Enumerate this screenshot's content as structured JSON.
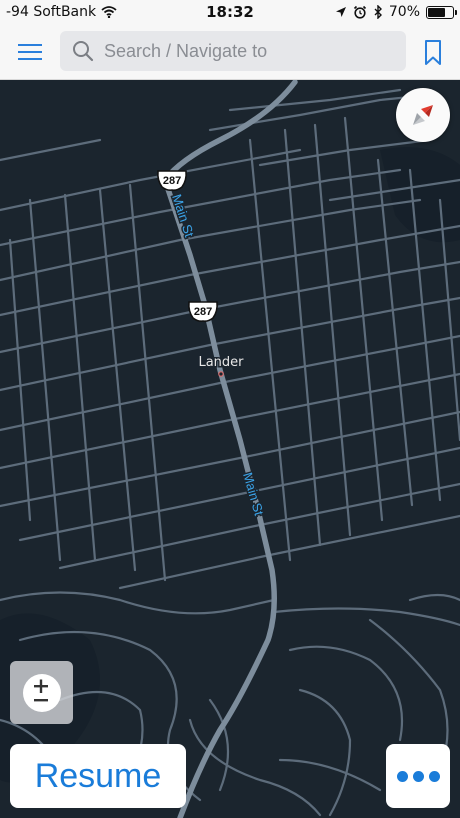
{
  "status_bar": {
    "carrier": "-94 SoftBank",
    "time": "18:32",
    "battery": "70%",
    "battery_level": 0.7,
    "icons": [
      "wifi-icon",
      "location-arrow-icon",
      "alarm-icon",
      "bluetooth-icon",
      "battery-icon"
    ]
  },
  "top_bar": {
    "search_placeholder": "Search / Navigate to",
    "menu_icon": "hamburger-menu-icon",
    "search_icon": "search-icon",
    "bookmark_icon": "bookmark-icon"
  },
  "map": {
    "city_label": "Lander",
    "street_label_upper": "Main St",
    "street_label_lower": "Main St",
    "highway_shield_upper": "287",
    "highway_shield_lower": "287",
    "colors": {
      "background": "#1b252e",
      "street": "#5d6c7b",
      "highway": "#7d8d9c",
      "street_label": "#3ba3e8",
      "city_label": "#e8e8e8",
      "accent": "#1a7cd9"
    }
  },
  "controls": {
    "compass_icon": "compass-icon",
    "zoom_icon": "zoom-plus-minus-icon",
    "resume_label": "Resume",
    "more_icon": "more-dots-icon"
  }
}
